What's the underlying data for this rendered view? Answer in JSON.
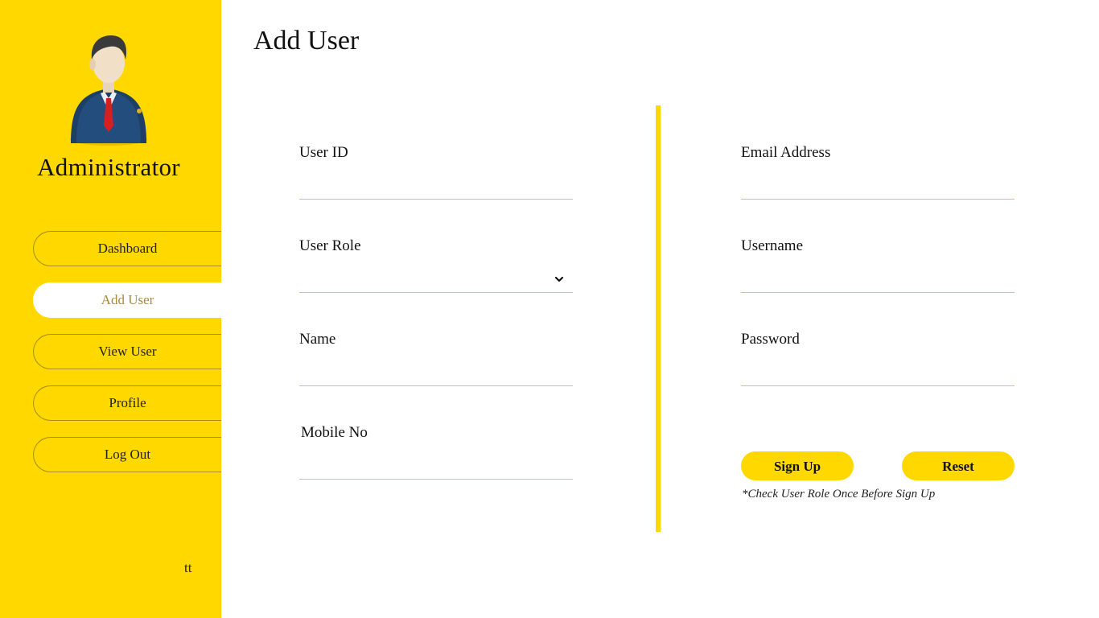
{
  "sidebar": {
    "role": "Administrator",
    "avatar_icon": "admin-businessman-icon",
    "nav": [
      {
        "label": "Dashboard",
        "active": false
      },
      {
        "label": "Add User",
        "active": true
      },
      {
        "label": "View User",
        "active": false
      },
      {
        "label": "Profile",
        "active": false
      },
      {
        "label": "Log Out",
        "active": false
      }
    ],
    "footer": "tt"
  },
  "main": {
    "title": "Add User",
    "left_fields": {
      "user_id": {
        "label": "User ID",
        "value": ""
      },
      "user_role": {
        "label": "User Role",
        "value": ""
      },
      "name": {
        "label": "Name",
        "value": ""
      },
      "mobile": {
        "label": "Mobile No",
        "value": ""
      }
    },
    "right_fields": {
      "email": {
        "label": "Email Address",
        "value": ""
      },
      "username": {
        "label": "Username",
        "value": ""
      },
      "password": {
        "label": "Password",
        "value": ""
      }
    },
    "buttons": {
      "signup": "Sign Up",
      "reset": "Reset"
    },
    "note": "*Check User Role Once Before Sign Up"
  },
  "colors": {
    "accent": "#FFD800",
    "active_text": "#A88A3A",
    "underline": "#E3C740"
  }
}
